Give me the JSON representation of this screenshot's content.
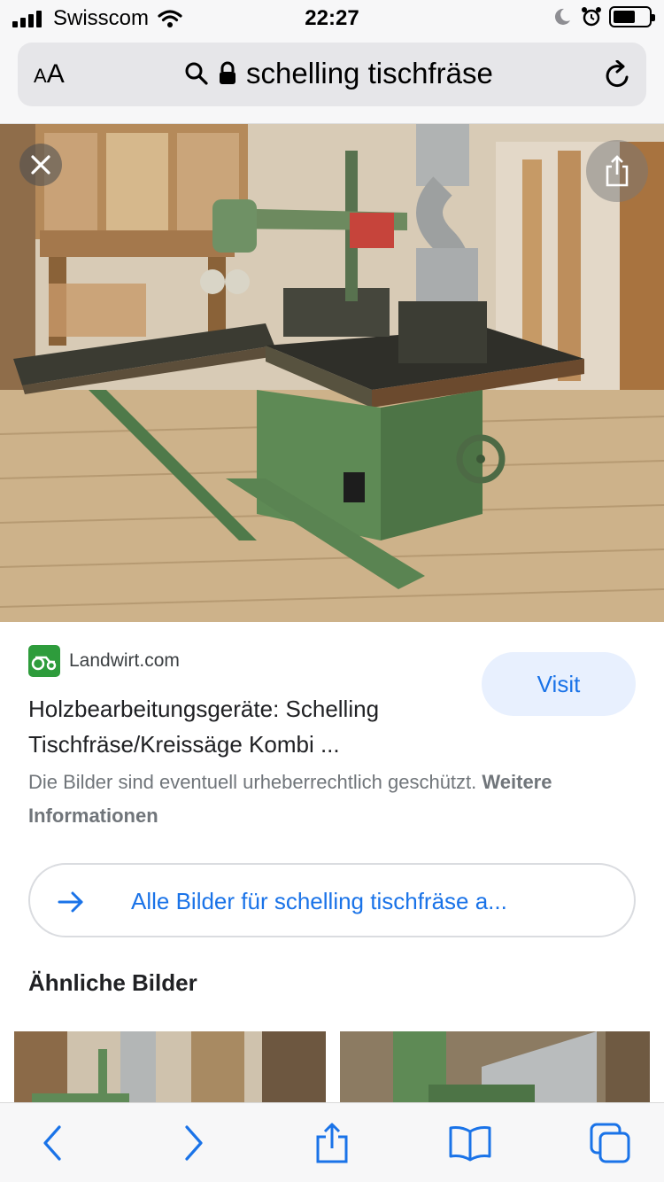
{
  "status_bar": {
    "carrier": "Swisscom",
    "time": "22:27"
  },
  "browser": {
    "text_size_label_small": "A",
    "text_size_label_big": "A",
    "url": "schelling tischfräse",
    "icons": [
      "search-icon",
      "lock-icon",
      "reload-icon"
    ]
  },
  "result": {
    "source_name": "Landwirt.com",
    "visit_label": "Visit",
    "title": "Holzbearbeitungsgeräte: Schelling Tischfräse/Kreissäge Kombi ...",
    "copyright_text": "Die Bilder sind eventuell urheberrechtlich geschützt.",
    "copyright_link": "Weitere Informationen",
    "all_images_label": "Alle Bilder für schelling tischfräse a...",
    "similar_heading": "Ähnliche Bilder"
  },
  "toolbar": {
    "icons": [
      "back-icon",
      "forward-icon",
      "share-icon",
      "bookmarks-icon",
      "tabs-icon"
    ]
  },
  "colors": {
    "accent": "#1a73e8",
    "visit_bg": "#e8f0fe",
    "machine_green": "#5e8a55"
  }
}
